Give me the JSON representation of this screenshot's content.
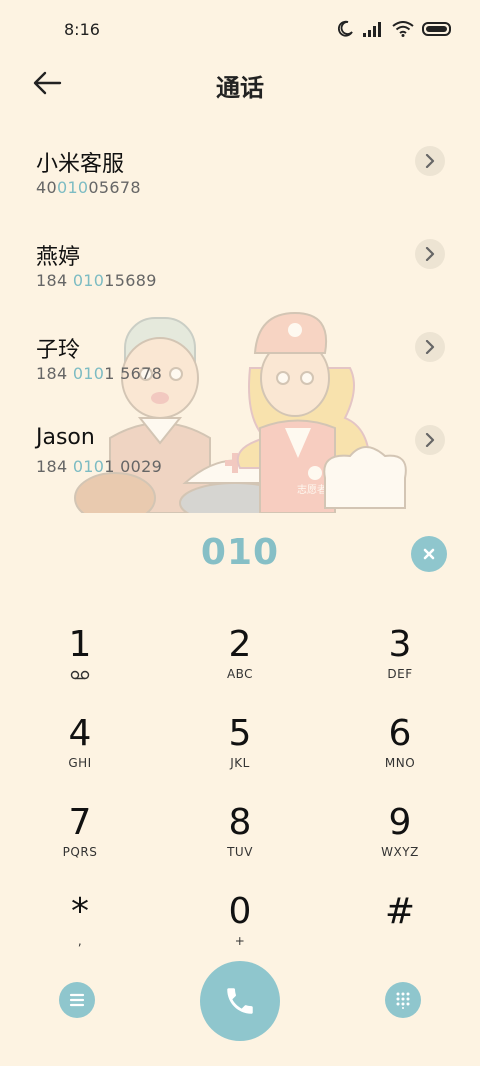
{
  "status": {
    "time": "8:16"
  },
  "header": {
    "title": "通话"
  },
  "contacts": [
    {
      "name": "小米客服",
      "num_pre": "40",
      "num_hl": "010",
      "num_post": "05678"
    },
    {
      "name": "燕婷",
      "num_pre": "184 ",
      "num_hl": "010",
      "num_post": "15689"
    },
    {
      "name": "子玲",
      "num_pre": "184 ",
      "num_hl": "010",
      "num_post": "1 5678"
    },
    {
      "name": "Jason",
      "num_pre": "184 ",
      "num_hl": "010",
      "num_post": "1 0029"
    }
  ],
  "illustration": {
    "badge_text": "志愿者"
  },
  "dialed": "010",
  "keypad": [
    {
      "digit": "1",
      "letters": ""
    },
    {
      "digit": "2",
      "letters": "ABC"
    },
    {
      "digit": "3",
      "letters": "DEF"
    },
    {
      "digit": "4",
      "letters": "GHI"
    },
    {
      "digit": "5",
      "letters": "JKL"
    },
    {
      "digit": "6",
      "letters": "MNO"
    },
    {
      "digit": "7",
      "letters": "PQRS"
    },
    {
      "digit": "8",
      "letters": "TUV"
    },
    {
      "digit": "9",
      "letters": "WXYZ"
    },
    {
      "digit": "*",
      "letters": ","
    },
    {
      "digit": "0",
      "letters": "+"
    },
    {
      "digit": "#",
      "letters": ""
    }
  ],
  "colors": {
    "accent": "#8FC6CD",
    "highlight": "#7DBCC3",
    "background": "#FDF3E2"
  }
}
